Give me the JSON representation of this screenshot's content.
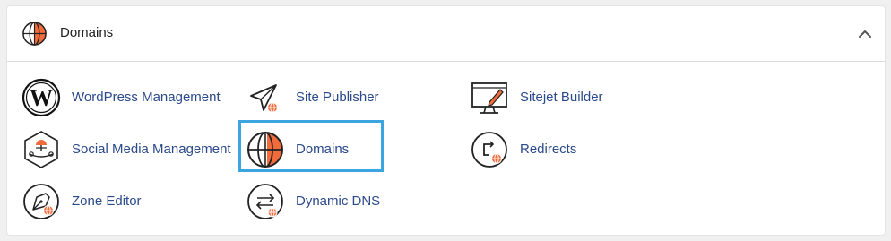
{
  "section": {
    "title": "Domains",
    "collapse_icon": "chevron-up-icon"
  },
  "tools": [
    {
      "label": "WordPress Management",
      "icon": "wordpress-icon"
    },
    {
      "label": "Site Publisher",
      "icon": "site-publisher-icon"
    },
    {
      "label": "Sitejet Builder",
      "icon": "sitejet-builder-icon"
    },
    {
      "label": "Social Media Management",
      "icon": "social-media-management-icon"
    },
    {
      "label": "Domains",
      "icon": "domains-globe-icon",
      "highlighted": true
    },
    {
      "label": "Redirects",
      "icon": "redirects-icon"
    },
    {
      "label": "Zone Editor",
      "icon": "zone-editor-icon"
    },
    {
      "label": "Dynamic DNS",
      "icon": "dynamic-dns-icon"
    }
  ],
  "colors": {
    "accent_orange": "#f26b3a",
    "link_blue": "#2b4a8b",
    "highlight_border": "#3ba5e0"
  }
}
